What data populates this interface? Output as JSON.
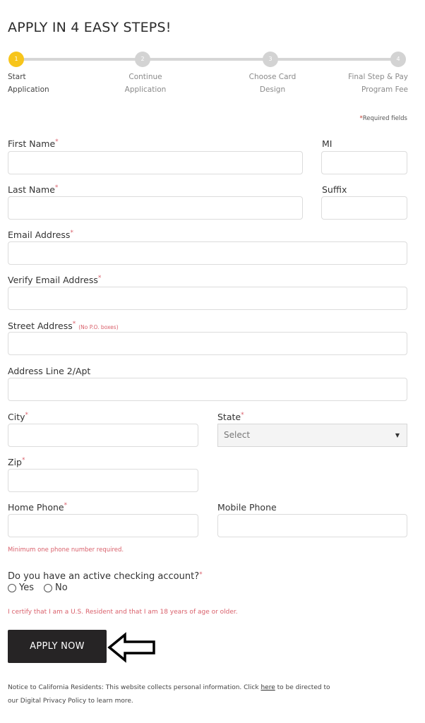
{
  "page": {
    "title": "APPLY IN 4 EASY STEPS!",
    "required_note": "Required fields"
  },
  "stepper": {
    "current_step": 1,
    "steps": [
      {
        "number": "1",
        "line1": "Start",
        "line2": "Application"
      },
      {
        "number": "2",
        "line1": "Continue",
        "line2": "Application"
      },
      {
        "number": "3",
        "line1": "Choose Card",
        "line2": "Design"
      },
      {
        "number": "4",
        "line1": "Final Step & Pay",
        "line2": "Program Fee"
      }
    ],
    "active_color": "#f7c51b",
    "inactive_color": "#d3d3d3"
  },
  "form": {
    "first_name": {
      "label": "First Name",
      "required": true,
      "value": ""
    },
    "mi": {
      "label": "MI",
      "required": false,
      "value": ""
    },
    "last_name": {
      "label": "Last Name",
      "required": true,
      "value": ""
    },
    "suffix": {
      "label": "Suffix",
      "required": false,
      "value": ""
    },
    "email": {
      "label": "Email Address",
      "required": true,
      "value": ""
    },
    "verify_email": {
      "label": "Verify Email Address",
      "required": true,
      "value": ""
    },
    "street": {
      "label": "Street Address",
      "required": true,
      "hint": "(No P.O. boxes)",
      "value": ""
    },
    "address2": {
      "label": "Address Line 2/Apt",
      "required": false,
      "value": ""
    },
    "city": {
      "label": "City",
      "required": true,
      "value": ""
    },
    "state": {
      "label": "State",
      "required": true,
      "selected": "Select"
    },
    "zip": {
      "label": "Zip",
      "required": true,
      "value": ""
    },
    "home_phone": {
      "label": "Home Phone",
      "required": true,
      "value": ""
    },
    "mobile_phone": {
      "label": "Mobile Phone",
      "required": false,
      "value": ""
    },
    "phone_note": "Minimum one phone number required.",
    "checking": {
      "question": "Do you have an active checking account?",
      "options": [
        "Yes",
        "No"
      ],
      "selected": null
    },
    "certify": "I certify that I am a U.S. Resident and that I am 18 years of age or older."
  },
  "actions": {
    "apply_label": "APPLY NOW"
  },
  "notice": {
    "before": "Notice to California Residents: This website collects personal information. Click ",
    "link": "here",
    "after": " to be directed to our Digital Privacy Policy to learn more."
  },
  "colors": {
    "required_marker": "#d9606b",
    "button_bg": "#262425"
  }
}
